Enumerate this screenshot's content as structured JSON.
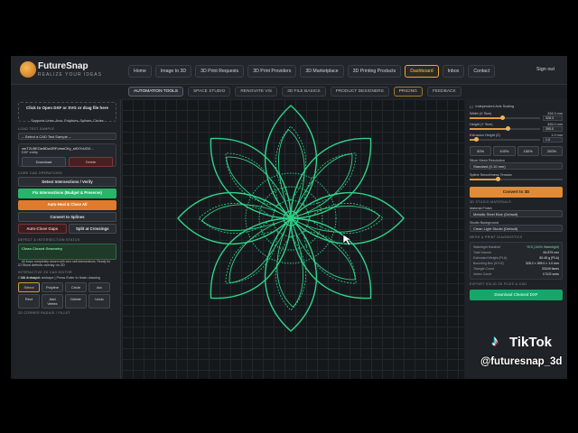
{
  "brand": {
    "name": "FutureSnap",
    "tagline": "REALIZE YOUR IDEAS"
  },
  "nav": [
    "Home",
    "Image to 3D",
    "3D Print Requests",
    "3D Print Providers",
    "3D Marketplace",
    "3D Printing Products",
    "Dashboard",
    "Inbox",
    "Contact"
  ],
  "nav_active": "Dashboard",
  "signout": "Sign out",
  "subnav": [
    "AUTOMATION TOOLS",
    "SPACE STUDIO",
    "RENOVATE VIS",
    "3D FILE BASICS",
    "PRODUCT DESIGNERS",
    "PRICING",
    "FEEDBACK"
  ],
  "left": {
    "upload_title": "Click to Open DXF or SVG or drag file here",
    "upload_sub": "Supports Lines, Arcs, Polylines, Splines, Circles",
    "sample_label": "LOAD TEST SAMPLE",
    "sample_select": "-- Select a CAD Test Sample --",
    "file_name": "vmT2U9EOw5Dw2RFohmCKy_s9XYrUGX...",
    "file_meta": "DXF entity",
    "download": "Download",
    "delete": "Delete",
    "ops_title": "CORE CAD OPERATIONS",
    "detect": "Detect Intersections / Verify",
    "fix": "Fix Intersections (Budget & Preserve)",
    "autoheal": "Auto-Heal & Close All",
    "convert": "Convert to Splines",
    "autoclose": "Auto-Close Gaps",
    "split": "Split at Crossings",
    "defect_title": "DEFECT & INTERSECTION STATUS",
    "status_title": "Clean Closed Geometry",
    "status_sub": "All loops completely closed with zero self-intersections. Ready for 3D extrusion!",
    "show_defects": "Show defects overlay on 2D",
    "editor_title": "INTERACTIVE 2D CAD EDITOR",
    "editor_hint": "Click & drag to reshape | Press Enter to finish drawing",
    "tools": [
      "Select",
      "Polyline",
      "Circle",
      "Arc",
      "Rect",
      "Add Vertex",
      "Delete",
      "Undo"
    ],
    "corner_title": "2D CORNER RADIUS / FILLET"
  },
  "right": {
    "auto_scale": "Independent Axis Scaling",
    "width_label": "Width (X Size)",
    "width_val": "328.3",
    "width_unit": "mm",
    "height_label": "Height (Y Size)",
    "height_val": "395.0",
    "height_unit": "mm",
    "extrude_label": "Extrusion Height (Z)",
    "extrude_val": "1.0",
    "extrude_unit": "mm",
    "pcts": [
      "50%",
      "100%",
      "150%",
      "200%"
    ],
    "mesh_label": "Slicer Mesh Resolution",
    "mesh_val": "Standard (0.10 mm)",
    "spline_label": "Spline Smoothness Tension",
    "convert": "Convert to 3D",
    "materials_title": "3D STUDIO MATERIALS",
    "material_label": "Material Finish",
    "material_val": "Metallic Steel Blue (Default)",
    "bg_label": "Studio Background",
    "bg_val": "Clean Light Studio (Default)",
    "diag_title": "MESH & PRINT DIAGNOSTICS",
    "diag": [
      [
        "Watertight Manifold",
        "YES (100% Watertight)"
      ],
      [
        "Total Volume",
        "64.879 cm³"
      ],
      [
        "Estimated Weight (PLA)",
        "80.45 g (PLA)"
      ],
      [
        "Bounding Box (X/Y/Z)",
        "328.2 × 395.0 × 1.0 mm"
      ],
      [
        "Triangle Count",
        "33249 faces"
      ],
      [
        "Vertex Count",
        "17102 verts"
      ]
    ],
    "export_title": "EXPORT SOLID 3D FILES & CAD",
    "export": "Download Cleaned DXF"
  },
  "overlay": {
    "tiktok": "TikTok",
    "username": "@futuresnap_3d"
  },
  "colors": {
    "accent": "#e7a93a",
    "pattern": "#2fd38a",
    "success": "#27b56a"
  }
}
